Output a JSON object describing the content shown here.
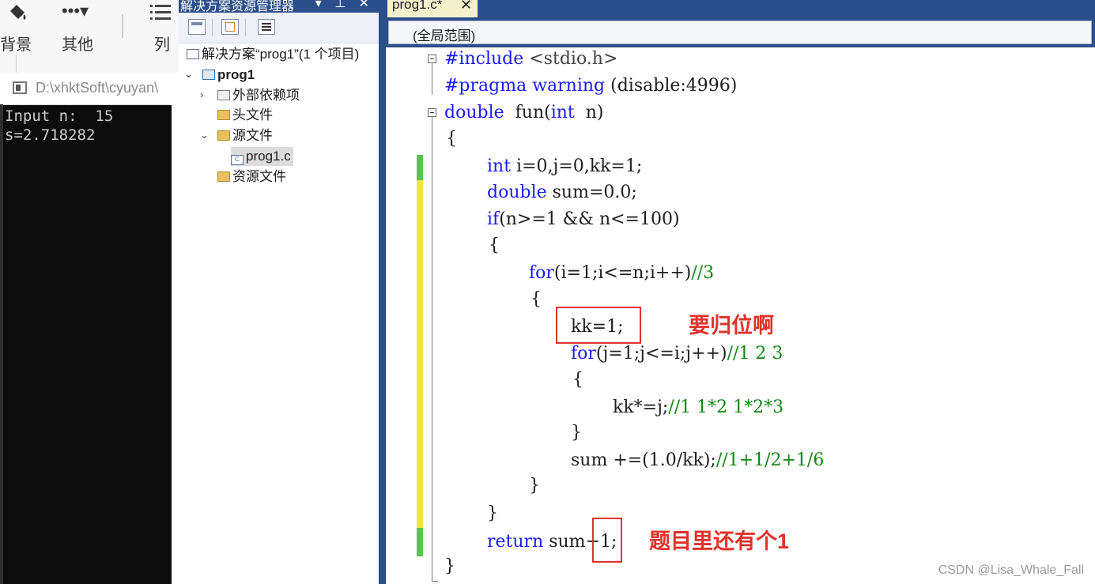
{
  "toolbar": {
    "background_label": "背景",
    "more_label": "其他",
    "list_label": "列"
  },
  "console": {
    "title": "D:\\xhktSoft\\cyuyan\\",
    "lines": [
      "Input n:  15",
      "s=2.718282"
    ]
  },
  "solution_explorer": {
    "title": "解决方案资源管理器",
    "controls": "▾ ⊥ ✕",
    "solution_label": "解决方案“prog1”(1 个项目)",
    "project_label": "prog1",
    "external_deps": "外部依赖项",
    "header_files": "头文件",
    "source_files": "源文件",
    "source_file_item": "prog1.c",
    "resource_files": "资源文件"
  },
  "editor": {
    "tab_label": "prog1.c*",
    "tab_close": "✕",
    "scope_label": "(全局范围)",
    "annotations": {
      "reset_note": "要归位啊",
      "plus_one_note": "题目里还有个1"
    }
  },
  "code": {
    "l1": [
      "#include ",
      "<stdio.h>"
    ],
    "l2": [
      "#pragma warning ",
      "(disable:4996)"
    ],
    "l3": [
      "double",
      "  fun(",
      "int",
      "  n)"
    ],
    "l4": "{",
    "l5": [
      "int",
      " i=0,j=0,kk=1;"
    ],
    "l6": [
      "double",
      " sum=0.0;"
    ],
    "l7": [
      "if",
      "(n>=1 && n<=100)"
    ],
    "l8": "{",
    "l9": [
      "for",
      "(i=1;i<=n;i++)",
      "//3"
    ],
    "l10": "{",
    "l11": "kk=1;",
    "l12": [
      "for",
      "(j=1;j<=i;j++)",
      "//1 2 3"
    ],
    "l13": "{",
    "l14": [
      "kk*=j;",
      "//1 1*2 1*2*3"
    ],
    "l15": "}",
    "l16": [
      "sum +=(1.0/kk);",
      "//1+1/2+1/6"
    ],
    "l17": "}",
    "l18": "}",
    "l19": [
      "return",
      " sum",
      "+1;"
    ],
    "l20": "}"
  },
  "watermark": "CSDN @Lisa_Whale_Fall",
  "colors": {
    "keyword": "#1a1aff",
    "comment": "#118811",
    "annotation": "#e0322b",
    "vs_blue": "#2b4f8a",
    "added_line": "#57c64c",
    "modified_line": "#f2e53b"
  }
}
